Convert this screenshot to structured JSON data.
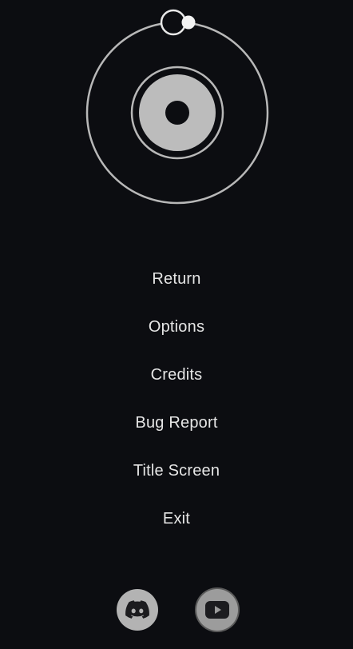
{
  "menu": {
    "items": [
      {
        "label": "Return"
      },
      {
        "label": "Options"
      },
      {
        "label": "Credits"
      },
      {
        "label": "Bug Report"
      },
      {
        "label": "Title Screen"
      },
      {
        "label": "Exit"
      }
    ]
  },
  "social": {
    "discord_icon": "discord-icon",
    "youtube_icon": "youtube-icon"
  },
  "colors": {
    "background": "#0c0d11",
    "text": "#e6e6e6",
    "emblem": "#bdbdbd"
  }
}
